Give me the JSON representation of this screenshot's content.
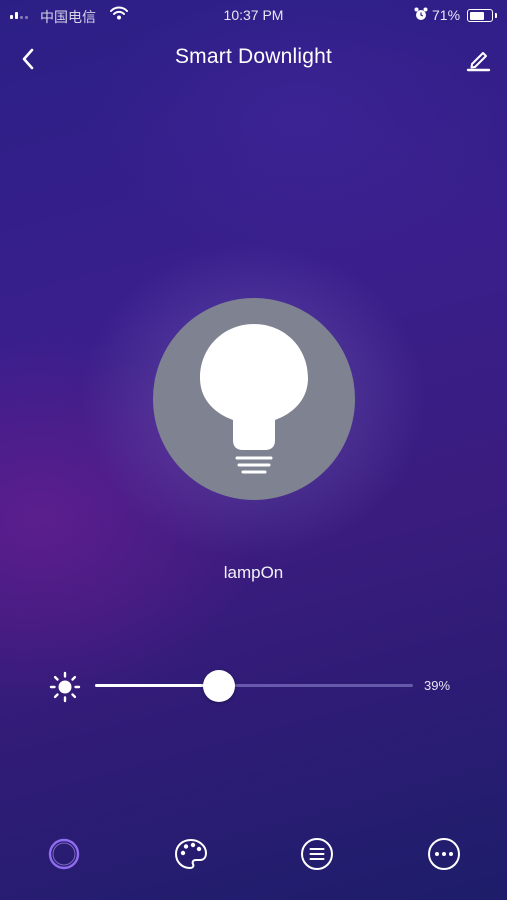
{
  "status_bar": {
    "carrier": "中国电信",
    "time": "10:37 PM",
    "battery_percent": "71%",
    "battery_level": 0.71
  },
  "nav": {
    "title": "Smart Downlight",
    "back_icon": "chevron-left-icon",
    "edit_icon": "pencil-icon"
  },
  "lamp": {
    "icon": "lightbulb-icon",
    "status": "lampOn"
  },
  "brightness": {
    "icon": "sun-icon",
    "value": 39,
    "label": "39%"
  },
  "tabs": [
    {
      "name": "tab-white-light",
      "icon": "ring-icon",
      "active": true
    },
    {
      "name": "tab-color",
      "icon": "palette-icon",
      "active": false
    },
    {
      "name": "tab-scenes",
      "icon": "list-icon",
      "active": false
    },
    {
      "name": "tab-more",
      "icon": "more-icon",
      "active": false
    }
  ],
  "colors": {
    "accent": "#8f6cf0",
    "lamp_circle": "#7f8391",
    "background": "#2b1f86"
  }
}
